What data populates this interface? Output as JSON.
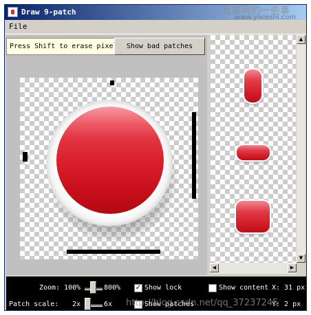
{
  "window": {
    "title": "Draw 9-patch"
  },
  "menu": {
    "file": "File"
  },
  "watermark": {
    "top": "互联网的一些事",
    "url": "www.yixieshi.com",
    "bottom": "http://blog.csdn.net/qq_37237245"
  },
  "toolbar": {
    "tooltip": "Press Shift to erase pixels",
    "bad_patches": "Show bad patches"
  },
  "status": {
    "zoom_label": "Zoom:",
    "zoom_min": "100%",
    "zoom_max": "800%",
    "show_lock": "Show lock",
    "show_lock_checked": true,
    "show_content": "Show content",
    "show_content_checked": false,
    "x_readout": "X: 31 px",
    "patch_label": "Patch scale:",
    "patch_min": "2x",
    "patch_max": "6x",
    "show_patches": "Show patches",
    "show_patches_checked": false,
    "y_readout": "Y: 2 px"
  },
  "scrollbar": {
    "up": "▲",
    "down": "▼",
    "left": "◀",
    "right": "▶"
  },
  "colors": {
    "accent_red": "#d91f2b",
    "title_blue": "#0a246a",
    "status_bg": "#000000"
  },
  "icons": {
    "app": "java-app-icon",
    "check": "✓"
  }
}
